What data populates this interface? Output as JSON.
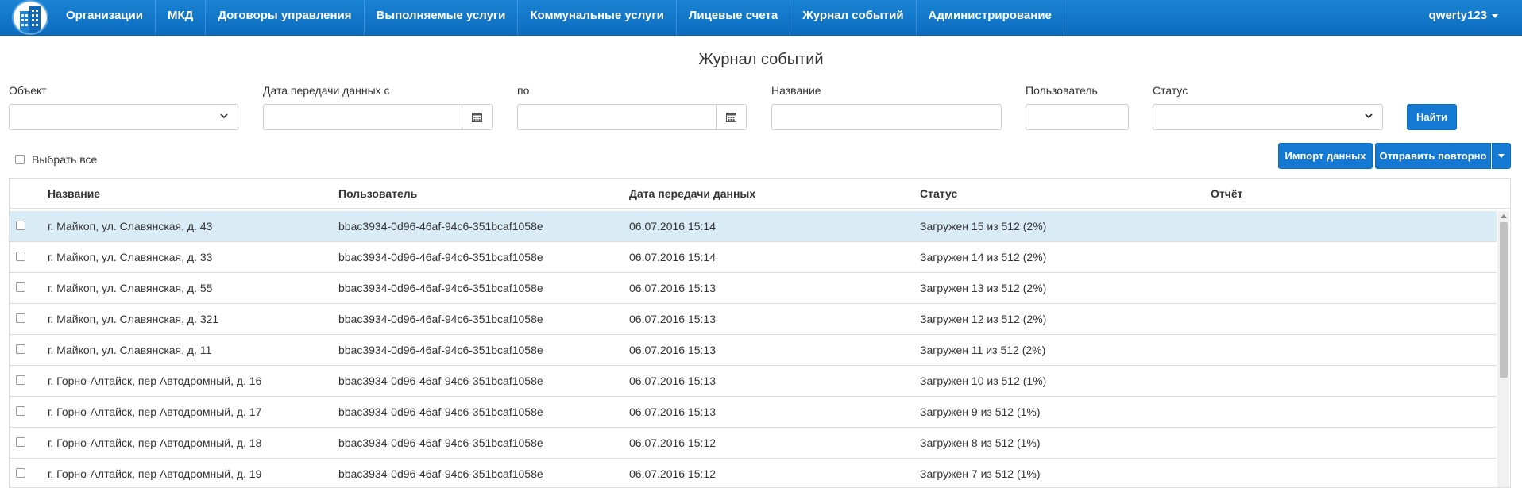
{
  "nav": {
    "items": [
      "Организации",
      "МКД",
      "Договоры управления",
      "Выполняемые услуги",
      "Коммунальные услуги",
      "Лицевые счета",
      "Журнал событий",
      "Администрирование"
    ],
    "user": "qwerty123"
  },
  "page": {
    "title": "Журнал событий"
  },
  "filters": {
    "object_label": "Объект",
    "date_from_label": "Дата передачи данных с",
    "date_to_label": "по",
    "name_label": "Название",
    "user_label": "Пользователь",
    "status_label": "Статус",
    "find_button": "Найти"
  },
  "toolbar": {
    "select_all": "Выбрать все",
    "import_button": "Импорт данных",
    "resend_button": "Отправить повторно"
  },
  "table": {
    "columns": [
      "Название",
      "Пользователь",
      "Дата передачи данных",
      "Статус",
      "Отчёт"
    ],
    "rows": [
      {
        "name": "г. Майкоп, ул. Славянская, д. 43",
        "user": "bbac3934-0d96-46af-94c6-351bcaf1058e",
        "date": "06.07.2016 15:14",
        "status": "Загружен 15 из 512 (2%)",
        "report": ""
      },
      {
        "name": "г. Майкоп, ул. Славянская, д. 33",
        "user": "bbac3934-0d96-46af-94c6-351bcaf1058e",
        "date": "06.07.2016 15:14",
        "status": "Загружен 14 из 512 (2%)",
        "report": ""
      },
      {
        "name": "г. Майкоп, ул. Славянская, д. 55",
        "user": "bbac3934-0d96-46af-94c6-351bcaf1058e",
        "date": "06.07.2016 15:13",
        "status": "Загружен 13 из 512 (2%)",
        "report": ""
      },
      {
        "name": "г. Майкоп, ул. Славянская, д. 321",
        "user": "bbac3934-0d96-46af-94c6-351bcaf1058e",
        "date": "06.07.2016 15:13",
        "status": "Загружен 12 из 512 (2%)",
        "report": ""
      },
      {
        "name": "г. Майкоп, ул. Славянская, д. 11",
        "user": "bbac3934-0d96-46af-94c6-351bcaf1058e",
        "date": "06.07.2016 15:13",
        "status": "Загружен 11 из 512 (2%)",
        "report": ""
      },
      {
        "name": "г. Горно-Алтайск, пер Автодромный, д. 16",
        "user": "bbac3934-0d96-46af-94c6-351bcaf1058e",
        "date": "06.07.2016 15:13",
        "status": "Загружен 10 из 512 (1%)",
        "report": ""
      },
      {
        "name": "г. Горно-Алтайск, пер Автодромный, д. 17",
        "user": "bbac3934-0d96-46af-94c6-351bcaf1058e",
        "date": "06.07.2016 15:13",
        "status": "Загружен 9 из 512 (1%)",
        "report": ""
      },
      {
        "name": "г. Горно-Алтайск, пер Автодромный, д. 18",
        "user": "bbac3934-0d96-46af-94c6-351bcaf1058e",
        "date": "06.07.2016 15:12",
        "status": "Загружен 8 из 512 (1%)",
        "report": ""
      },
      {
        "name": "г. Горно-Алтайск, пер Автодромный, д. 19",
        "user": "bbac3934-0d96-46af-94c6-351bcaf1058e",
        "date": "06.07.2016 15:12",
        "status": "Загружен 7 из 512 (1%)",
        "report": ""
      }
    ]
  }
}
